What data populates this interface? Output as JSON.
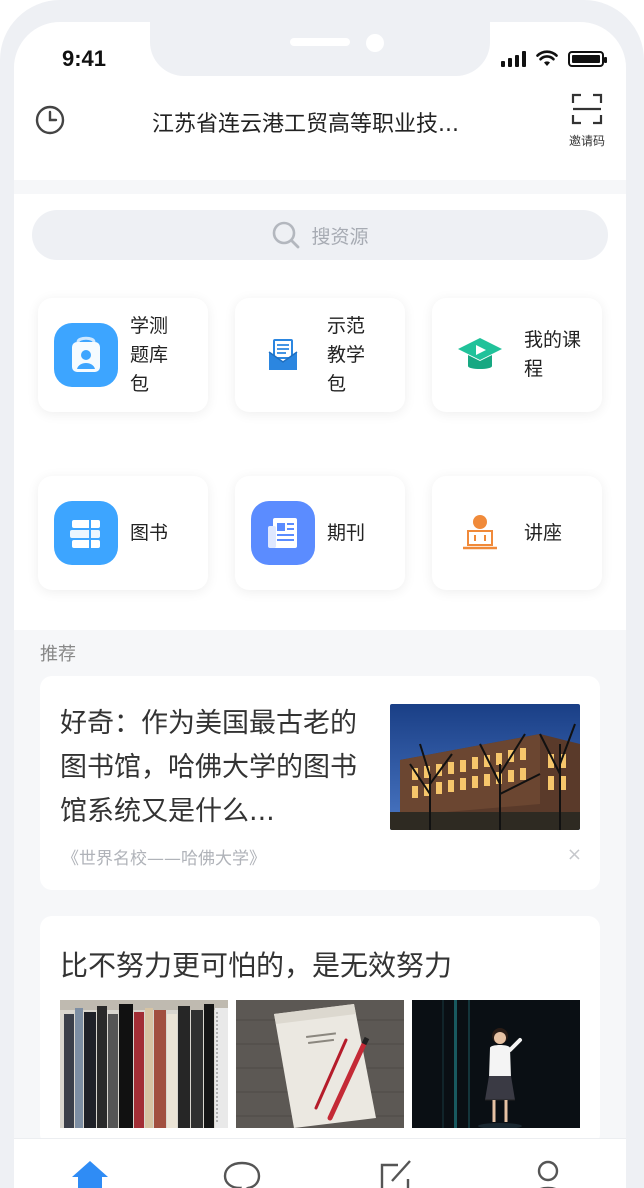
{
  "status_bar": {
    "time": "9:41"
  },
  "header": {
    "title": "江苏省连云港工贸高等职业技...",
    "invite_label": "邀请码"
  },
  "search": {
    "placeholder": "搜资源"
  },
  "tiles": [
    {
      "label": "学测题库包",
      "icon": "quiz-bag-icon",
      "color": "#3da5ff"
    },
    {
      "label": "示范教学包",
      "icon": "envelope-icon",
      "color": "#2b86e0"
    },
    {
      "label": "我的课程",
      "icon": "course-cap-icon",
      "color": "#20c29a"
    },
    {
      "label": "图书",
      "icon": "books-icon",
      "color": "#3da5ff"
    },
    {
      "label": "期刊",
      "icon": "journal-icon",
      "color": "#5b8cff"
    },
    {
      "label": "讲座",
      "icon": "lecture-icon",
      "color": "#f08a3a"
    }
  ],
  "recommend": {
    "section_label": "推荐",
    "articles": [
      {
        "title": "好奇：作为美国最古老的图书馆，哈佛大学的图书馆系统又是什么...",
        "source": "《世界名校——哈佛大学》",
        "close": "×"
      },
      {
        "title": "比不努力更可怕的，是无效努力"
      }
    ]
  },
  "tab_bar": {
    "tabs": [
      "home-icon",
      "message-icon",
      "edit-icon",
      "profile-icon"
    ],
    "active": 0,
    "active_color": "#2f8cf5"
  }
}
